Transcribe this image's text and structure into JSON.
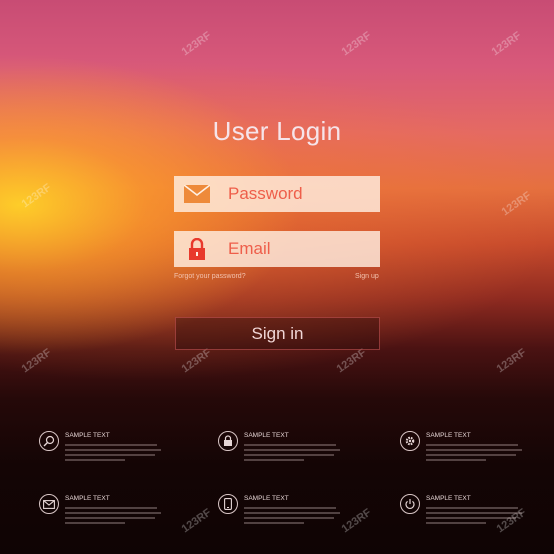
{
  "login": {
    "title": "User Login",
    "password_label": "Password",
    "email_label": "Email",
    "forgot_link": "Forgot your password?",
    "signup_link": "Sign up",
    "signin_button": "Sign in"
  },
  "features": [
    {
      "icon": "search-icon",
      "title": "SAMPLE TEXT"
    },
    {
      "icon": "lock-icon",
      "title": "SAMPLE TEXT"
    },
    {
      "icon": "gear-icon",
      "title": "SAMPLE TEXT"
    },
    {
      "icon": "mail-icon",
      "title": "SAMPLE TEXT"
    },
    {
      "icon": "phone-icon",
      "title": "SAMPLE TEXT"
    },
    {
      "icon": "power-icon",
      "title": "SAMPLE TEXT"
    }
  ],
  "watermark": "123RF",
  "colors": {
    "accent": "#ee5e4a",
    "field_bg": "#ffeee1"
  }
}
